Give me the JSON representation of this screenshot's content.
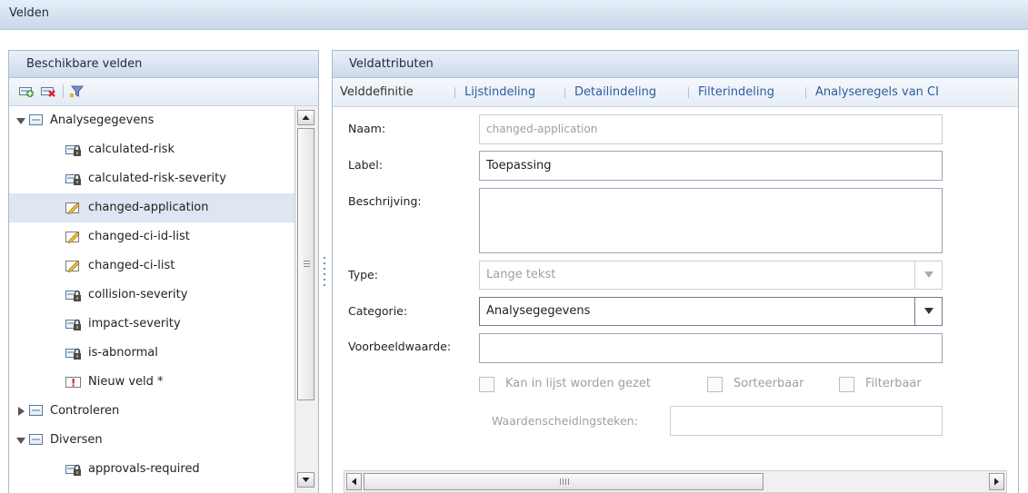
{
  "window": {
    "title": "Velden"
  },
  "left_panel": {
    "title": "Beschikbare velden",
    "toolbar": [
      "add-field-icon",
      "delete-field-icon",
      "filter-icon"
    ],
    "tree": [
      {
        "type": "group",
        "expanded": true,
        "label": "Analysegegevens"
      },
      {
        "type": "field",
        "icon": "locked-field-icon",
        "label": "calculated-risk"
      },
      {
        "type": "field",
        "icon": "locked-field-icon",
        "label": "calculated-risk-severity"
      },
      {
        "type": "field",
        "icon": "editable-field-icon",
        "label": "changed-application",
        "selected": true
      },
      {
        "type": "field",
        "icon": "editable-field-icon",
        "label": "changed-ci-id-list"
      },
      {
        "type": "field",
        "icon": "editable-field-icon",
        "label": "changed-ci-list"
      },
      {
        "type": "field",
        "icon": "locked-field-icon",
        "label": "collision-severity"
      },
      {
        "type": "field",
        "icon": "locked-field-icon",
        "label": "impact-severity"
      },
      {
        "type": "field",
        "icon": "locked-field-icon",
        "label": "is-abnormal"
      },
      {
        "type": "field",
        "icon": "new-field-warning-icon",
        "label": "Nieuw veld *"
      },
      {
        "type": "group",
        "expanded": false,
        "label": "Controleren"
      },
      {
        "type": "group",
        "expanded": true,
        "label": "Diversen"
      },
      {
        "type": "field",
        "icon": "locked-field-icon",
        "label": "approvals-required"
      }
    ]
  },
  "right_panel": {
    "title": "Veldattributen",
    "tabs": [
      {
        "label": "Velddefinitie",
        "active": true
      },
      {
        "label": "Lijstindeling",
        "active": false
      },
      {
        "label": "Detailindeling",
        "active": false
      },
      {
        "label": "Filterindeling",
        "active": false
      },
      {
        "label": "Analyseregels van CI",
        "active": false
      }
    ],
    "form": {
      "name_label": "Naam:",
      "name_value": "changed-application",
      "label_label": "Label:",
      "label_value": "Toepassing",
      "description_label": "Beschrijving:",
      "description_value": "",
      "type_label": "Type:",
      "type_value": "Lange tekst",
      "category_label": "Categorie:",
      "category_value": "Analysegegevens",
      "example_label": "Voorbeeldwaarde:",
      "example_value": "",
      "checkbox_listable": "Kan in lijst worden gezet",
      "checkbox_sortable": "Sorteerbaar",
      "checkbox_filterable": "Filterbaar",
      "separator_label": "Waardenscheidingsteken:",
      "separator_value": ""
    }
  }
}
